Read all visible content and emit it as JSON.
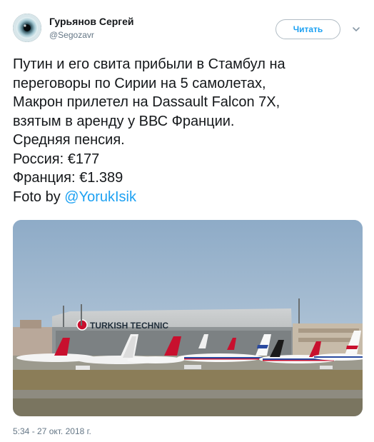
{
  "user": {
    "name": "Гурьянов Сергей",
    "handle": "@Segozavr"
  },
  "follow_button": {
    "label": "Читать"
  },
  "tweet": {
    "lines": [
      "Путин и его свита прибыли в Стамбул на",
      "переговоры по Сирии на 5 самолетах,",
      "Макрон прилетел на Dassault Falcon 7X,",
      "взятым в аренду у ВВС Франции.",
      "Средняя пенсия.",
      "Россия: €177",
      "Франция: €1.389"
    ],
    "credit_prefix": "Foto by ",
    "credit_mention": "@YorukIsik"
  },
  "photo": {
    "hangar_sign": "TURKISH TECHNIC"
  },
  "timestamp": "5:34 - 27 окт. 2018 г.",
  "colors": {
    "link": "#1da1f2",
    "text": "#14171a",
    "muted": "#657786",
    "sky": "#9fb8d2"
  },
  "icons": [
    "avatar-eye-icon",
    "chevron-down-icon"
  ]
}
